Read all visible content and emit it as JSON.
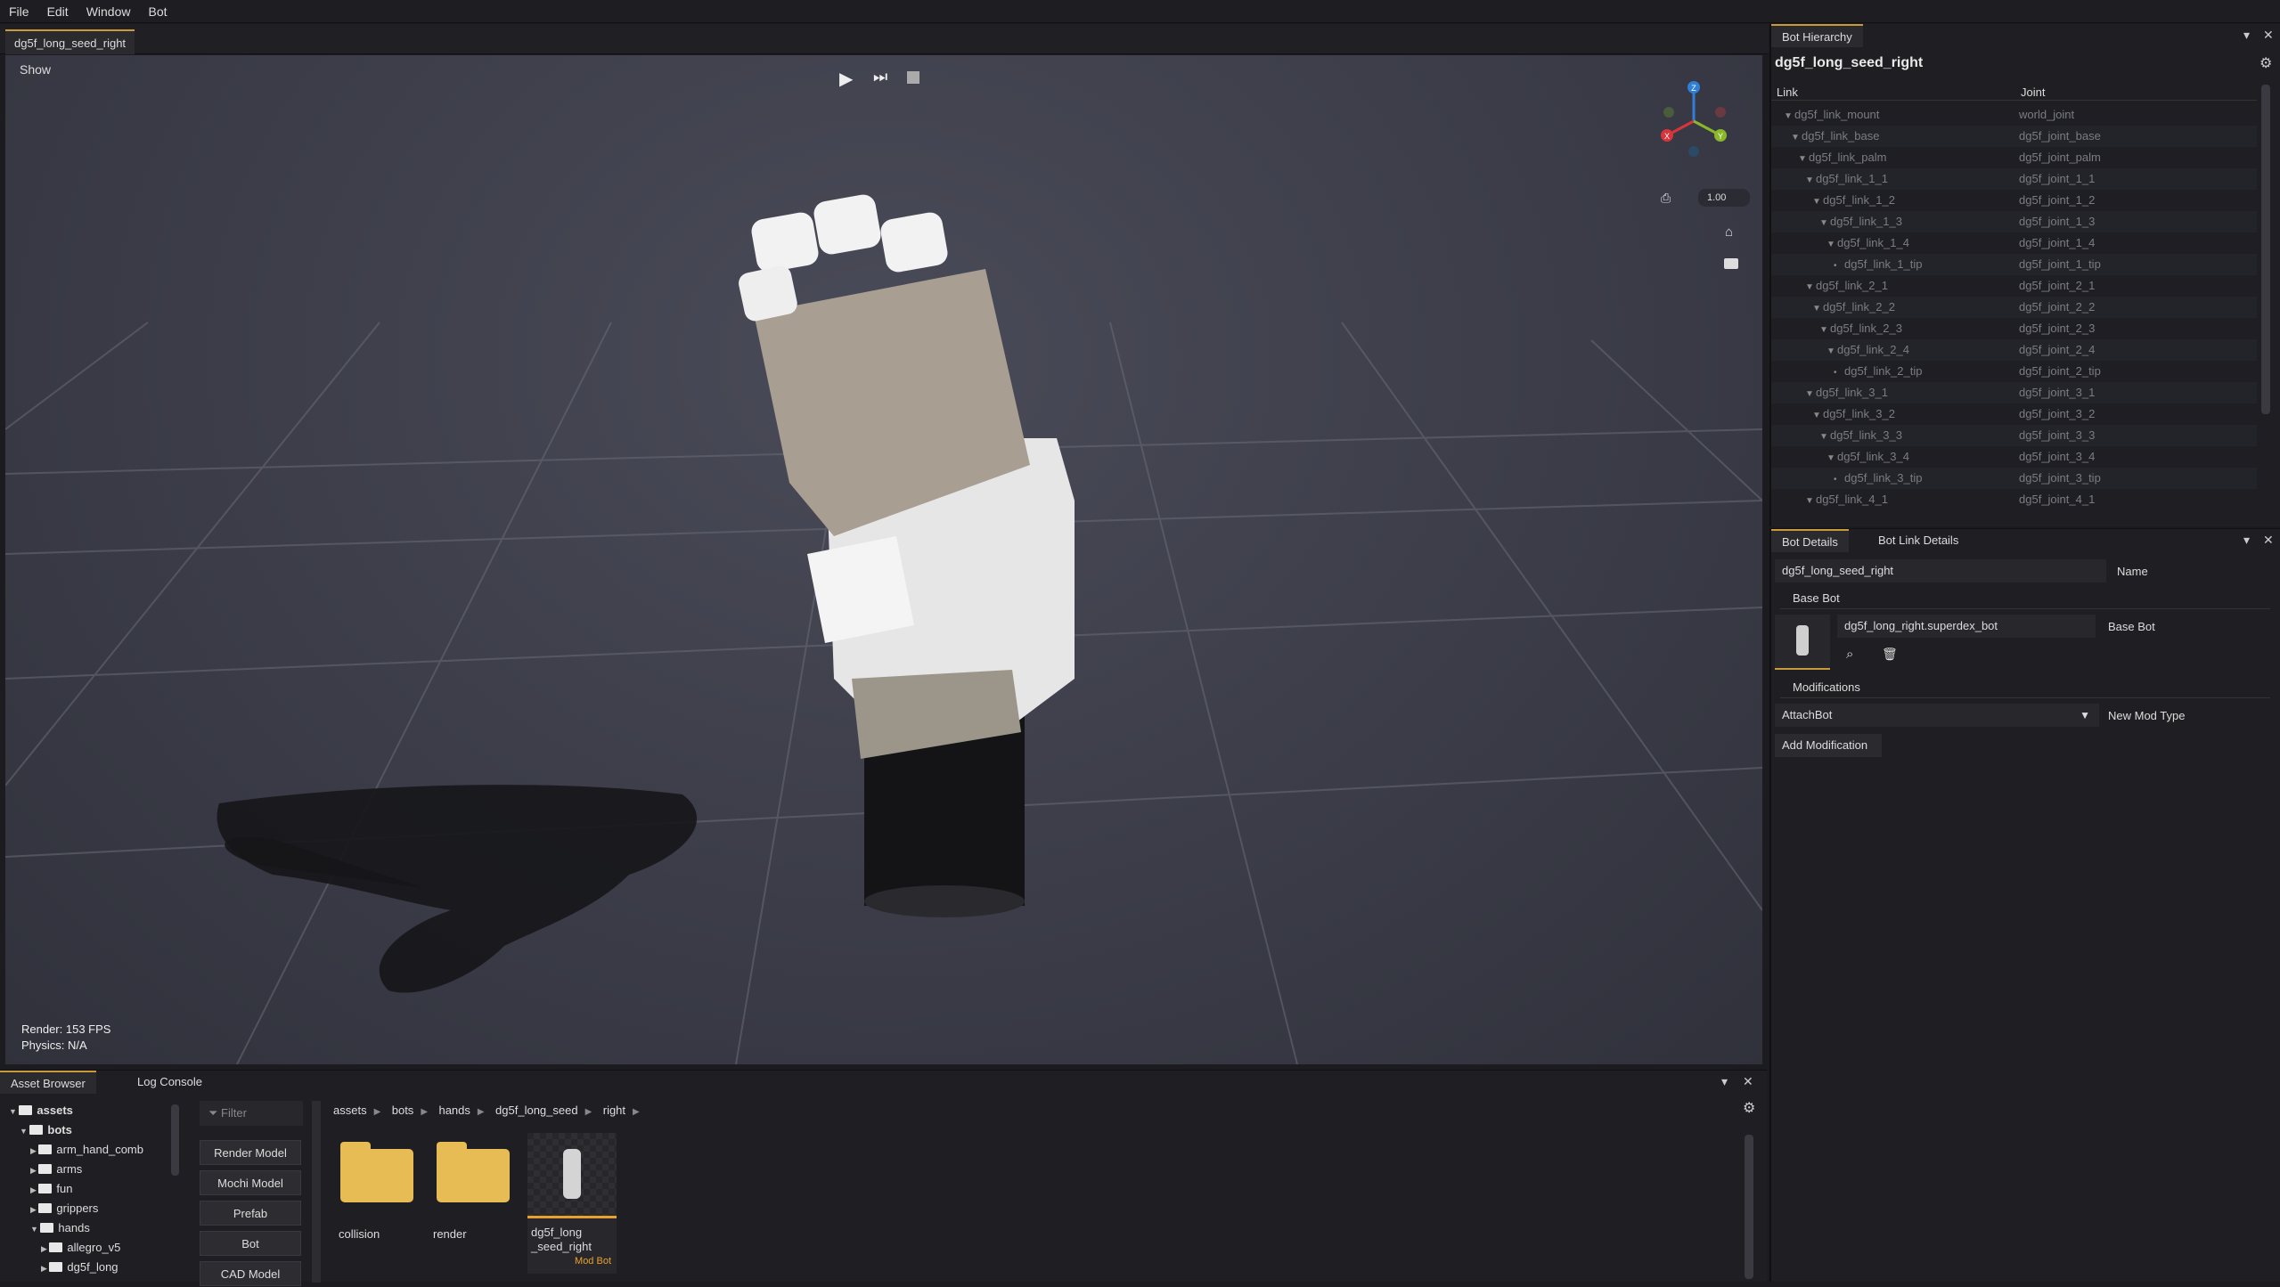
{
  "menu": [
    "File",
    "Edit",
    "Window",
    "Bot"
  ],
  "viewport": {
    "tab": "dg5f_long_seed_right",
    "show_label": "Show",
    "zoom_value": "1.00",
    "axis_labels": {
      "z": "Z",
      "x": "X",
      "y": "Y"
    },
    "stats": {
      "render": "Render:  153 FPS",
      "physics": "Physics: N/A"
    }
  },
  "hierarchy": {
    "tab": "Bot Hierarchy",
    "title": "dg5f_long_seed_right",
    "col_link": "Link",
    "col_joint": "Joint",
    "rows": [
      {
        "link": "dg5f_link_mount",
        "joint": "world_joint",
        "depth": 0
      },
      {
        "link": "dg5f_link_base",
        "joint": "dg5f_joint_base",
        "depth": 1
      },
      {
        "link": "dg5f_link_palm",
        "joint": "dg5f_joint_palm",
        "depth": 2
      },
      {
        "link": "dg5f_link_1_1",
        "joint": "dg5f_joint_1_1",
        "depth": 3
      },
      {
        "link": "dg5f_link_1_2",
        "joint": "dg5f_joint_1_2",
        "depth": 4
      },
      {
        "link": "dg5f_link_1_3",
        "joint": "dg5f_joint_1_3",
        "depth": 5
      },
      {
        "link": "dg5f_link_1_4",
        "joint": "dg5f_joint_1_4",
        "depth": 6
      },
      {
        "link": "dg5f_link_1_tip",
        "joint": "dg5f_joint_1_tip",
        "depth": 7
      },
      {
        "link": "dg5f_link_2_1",
        "joint": "dg5f_joint_2_1",
        "depth": 3
      },
      {
        "link": "dg5f_link_2_2",
        "joint": "dg5f_joint_2_2",
        "depth": 4
      },
      {
        "link": "dg5f_link_2_3",
        "joint": "dg5f_joint_2_3",
        "depth": 5
      },
      {
        "link": "dg5f_link_2_4",
        "joint": "dg5f_joint_2_4",
        "depth": 6
      },
      {
        "link": "dg5f_link_2_tip",
        "joint": "dg5f_joint_2_tip",
        "depth": 7
      },
      {
        "link": "dg5f_link_3_1",
        "joint": "dg5f_joint_3_1",
        "depth": 3
      },
      {
        "link": "dg5f_link_3_2",
        "joint": "dg5f_joint_3_2",
        "depth": 4
      },
      {
        "link": "dg5f_link_3_3",
        "joint": "dg5f_joint_3_3",
        "depth": 5
      },
      {
        "link": "dg5f_link_3_4",
        "joint": "dg5f_joint_3_4",
        "depth": 6
      },
      {
        "link": "dg5f_link_3_tip",
        "joint": "dg5f_joint_3_tip",
        "depth": 7
      },
      {
        "link": "dg5f_link_4_1",
        "joint": "dg5f_joint_4_1",
        "depth": 3
      }
    ]
  },
  "details": {
    "tab_bot": "Bot Details",
    "tab_link": "Bot Link Details",
    "name_value": "dg5f_long_seed_right",
    "name_label": "Name",
    "base_bot_section": "Base Bot",
    "base_bot_value": "dg5f_long_right.superdex_bot",
    "base_bot_label": "Base Bot",
    "modifications_section": "Modifications",
    "mod_type_value": "AttachBot",
    "mod_type_label": "New Mod Type",
    "add_modification": "Add Modification"
  },
  "bottom": {
    "tab_assets": "Asset Browser",
    "tab_log": "Log Console",
    "filter_placeholder": "Filter",
    "tree": [
      {
        "label": "assets",
        "depth": 0,
        "arrow": "▼",
        "bold": true
      },
      {
        "label": "bots",
        "depth": 1,
        "arrow": "▼",
        "bold": true
      },
      {
        "label": "arm_hand_comb",
        "depth": 2,
        "arrow": "▶"
      },
      {
        "label": "arms",
        "depth": 2,
        "arrow": "▶"
      },
      {
        "label": "fun",
        "depth": 2,
        "arrow": "▶"
      },
      {
        "label": "grippers",
        "depth": 2,
        "arrow": "▶"
      },
      {
        "label": "hands",
        "depth": 2,
        "arrow": "▼"
      },
      {
        "label": "allegro_v5",
        "depth": 3,
        "arrow": "▶"
      },
      {
        "label": "dg5f_long",
        "depth": 3,
        "arrow": "▶"
      }
    ],
    "types": [
      "Render Model",
      "Mochi Model",
      "Prefab",
      "Bot",
      "CAD Model"
    ],
    "breadcrumb": [
      "assets",
      "bots",
      "hands",
      "dg5f_long_seed",
      "right"
    ],
    "tiles": {
      "collision": "collision",
      "render": "render",
      "bot_name_line1": "dg5f_long",
      "bot_name_line2": "_seed_right",
      "bot_badge": "Mod Bot"
    }
  },
  "colors": {
    "accent": "#c89a3a",
    "folder": "#e8bc55",
    "axis_x": "#d8343b",
    "axis_y": "#8ab82a",
    "axis_z": "#2f7fd6"
  }
}
